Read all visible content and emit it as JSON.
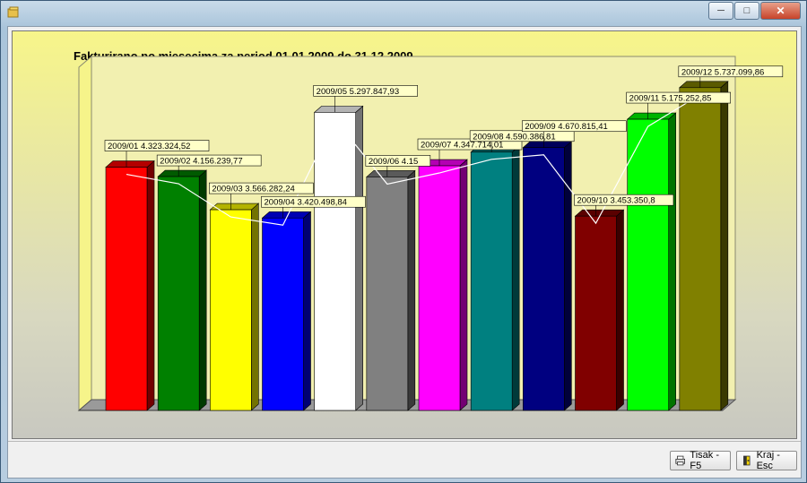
{
  "window": {
    "title": ""
  },
  "buttons": {
    "print_label": "Tisak - F5",
    "close_label": "Kraj - Esc"
  },
  "chart_data": {
    "type": "bar",
    "title": "Fakturirano po mjesecima za period 01.01.2009 do 31.12.2009",
    "xlabel": "",
    "ylabel": "",
    "ylim": [
      0,
      6100000
    ],
    "grid": false,
    "legend": "none",
    "categories": [
      "2009/01",
      "2009/02",
      "2009/03",
      "2009/04",
      "2009/05",
      "2009/06",
      "2009/07",
      "2009/08",
      "2009/09",
      "2009/10",
      "2009/11",
      "2009/12"
    ],
    "values": [
      4323324.52,
      4156239.77,
      3566282.24,
      3420498.84,
      5297847.93,
      4150000,
      4347714.01,
      4590386.81,
      4670815.41,
      3453350.8,
      5175252.85,
      5737099.86
    ],
    "data_labels": [
      "2009/01 4.323.324,52",
      "2009/02 4.156.239,77",
      "2009/03 3.566.282,24",
      "2009/04 3.420.498,84",
      "2009/05 5.297.847,93",
      "2009/06 4.15",
      "2009/07 4.347.714,01",
      "2009/08 4.590.386,81",
      "2009/09 4.670.815,41",
      "2009/10 3.453.350,8",
      "2009/11 5.175.252,85",
      "2009/12 5.737.099,86"
    ],
    "colors": [
      "#ff0000",
      "#008000",
      "#ffff00",
      "#0000ff",
      "#ffffff",
      "#808080",
      "#ff00ff",
      "#008080",
      "#000080",
      "#800000",
      "#00ff00",
      "#808000"
    ]
  }
}
